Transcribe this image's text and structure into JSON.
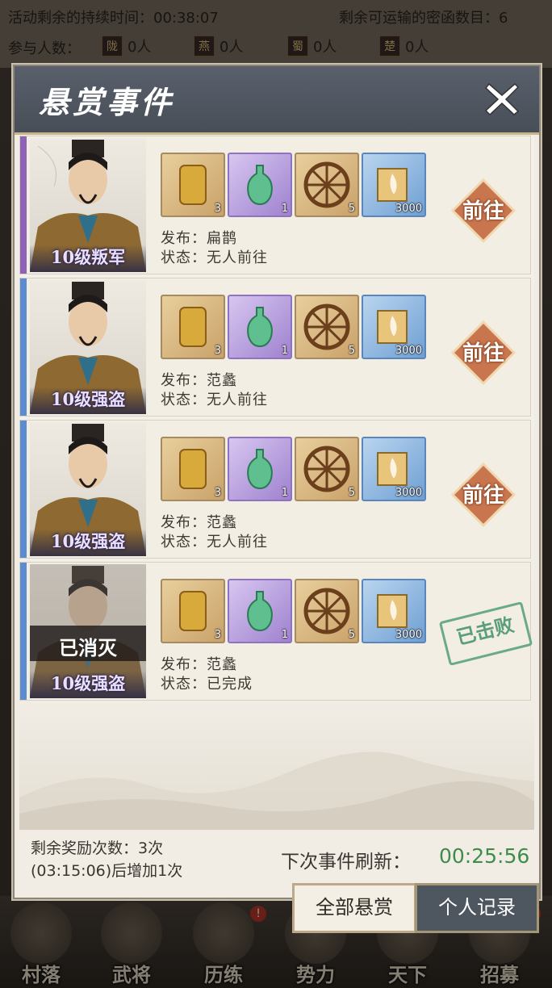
{
  "background": {
    "duration_label": "活动剩余的持续时间：00:38:07",
    "remaining_label": "剩余可运输的密函数目：6",
    "participants_label": "参与人数：",
    "factions": [
      {
        "name": "陇",
        "count": "0人"
      },
      {
        "name": "燕",
        "count": "0人"
      },
      {
        "name": "蜀",
        "count": "0人"
      },
      {
        "name": "楚",
        "count": "0人"
      }
    ],
    "nav": [
      {
        "label": "村落",
        "badge": ""
      },
      {
        "label": "武将",
        "badge": ""
      },
      {
        "label": "历练",
        "badge": "!"
      },
      {
        "label": "势力",
        "badge": ""
      },
      {
        "label": "天下",
        "badge": "!"
      },
      {
        "label": "招募",
        "badge": "!"
      }
    ]
  },
  "modal": {
    "title": "悬赏事件",
    "bounties": [
      {
        "level": "10级叛军",
        "stripe_color": "#8f62b8",
        "publisher": "发布：扁鹊",
        "status": "状态：无人前往",
        "rewards": [
          "3",
          "1",
          "5",
          "3000"
        ],
        "action": "前往",
        "defeated": false
      },
      {
        "level": "10级强盗",
        "stripe_color": "#5b8ccf",
        "publisher": "发布：范蠡",
        "status": "状态：无人前往",
        "rewards": [
          "3",
          "1",
          "5",
          "3000"
        ],
        "action": "前往",
        "defeated": false
      },
      {
        "level": "10级强盗",
        "stripe_color": "#5b8ccf",
        "publisher": "发布：范蠡",
        "status": "状态：无人前往",
        "rewards": [
          "3",
          "1",
          "5",
          "3000"
        ],
        "action": "前往",
        "defeated": false
      },
      {
        "level": "10级强盗",
        "stripe_color": "#5b8ccf",
        "publisher": "发布：范蠡",
        "status": "状态：已完成",
        "rewards": [
          "3",
          "1",
          "5",
          "3000"
        ],
        "eliminated_label": "已消灭",
        "stamp": "已击败",
        "defeated": true
      }
    ],
    "footer": {
      "remaining_rewards": "剩余奖励次数：3次",
      "increase_note": "(03:15:06)后增加1次",
      "refresh_label": "下次事件刷新：",
      "refresh_time": "00:25:56"
    },
    "buttons": {
      "all_bounties": "全部悬赏",
      "personal_records": "个人记录"
    }
  }
}
